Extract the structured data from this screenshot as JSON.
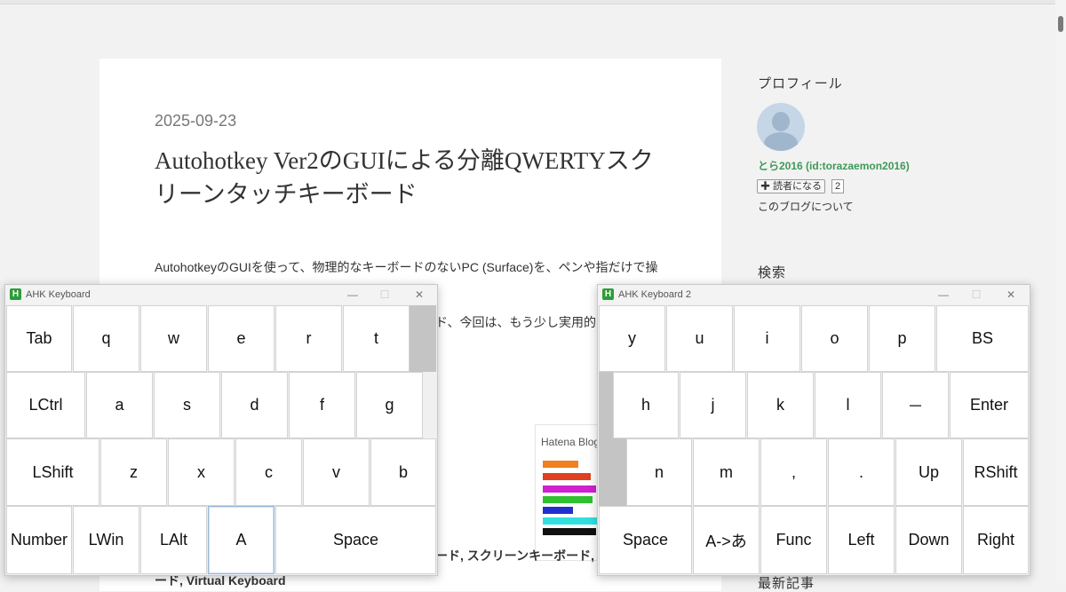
{
  "article": {
    "date": "2025-09-23",
    "title": "Autohotkey Ver2のGUIによる分離QWERTYスクリーンタッチキーボード",
    "intro": "AutohotkeyのGUIを使って、物理的なキーボードのないPC (Surface)を、ペンや指だけで操",
    "line2_fragment": "ド、今回は、もう少し実用的な",
    "tags_fragment": "ード, スクリーンキーボード,",
    "tags_line2": "ード, Virtual Keyboard",
    "hatena_logo": "Hatena Blog"
  },
  "sidebar": {
    "profile_heading": "プロフィール",
    "user_name": "とら2016 (id:torazaemon2016)",
    "subscribe_label": "✚ 読者になる",
    "reader_count": "2",
    "about_link": "このブログについて",
    "search_heading": "検索",
    "recent_heading": "最新記事"
  },
  "keyboard1": {
    "title": "AHK Keyboard",
    "app_icon": "H",
    "minimize": "—",
    "maximize": "☐",
    "close": "✕",
    "rows": [
      [
        "Tab",
        "q",
        "w",
        "e",
        "r",
        "t"
      ],
      [
        "LCtrl",
        "a",
        "s",
        "d",
        "f",
        "g"
      ],
      [
        "LShift",
        "z",
        "x",
        "c",
        "v",
        "b"
      ],
      [
        "Number",
        "LWin",
        "LAlt",
        "A",
        "Space"
      ]
    ]
  },
  "keyboard2": {
    "title": "AHK Keyboard 2",
    "app_icon": "H",
    "minimize": "—",
    "maximize": "☐",
    "close": "✕",
    "rows": [
      [
        "y",
        "u",
        "i",
        "o",
        "p",
        "BS"
      ],
      [
        "h",
        "j",
        "k",
        "l",
        "－",
        "Enter"
      ],
      [
        "n",
        "m",
        ",",
        ".",
        "Up",
        "RShift"
      ],
      [
        "Space",
        "A->あ",
        "Func",
        "Left",
        "Down",
        "Right"
      ]
    ]
  },
  "colors": {
    "accent_green": "#3d9a57",
    "key_bg": "#ffffff",
    "gap_gray": "#c4c4c4"
  }
}
